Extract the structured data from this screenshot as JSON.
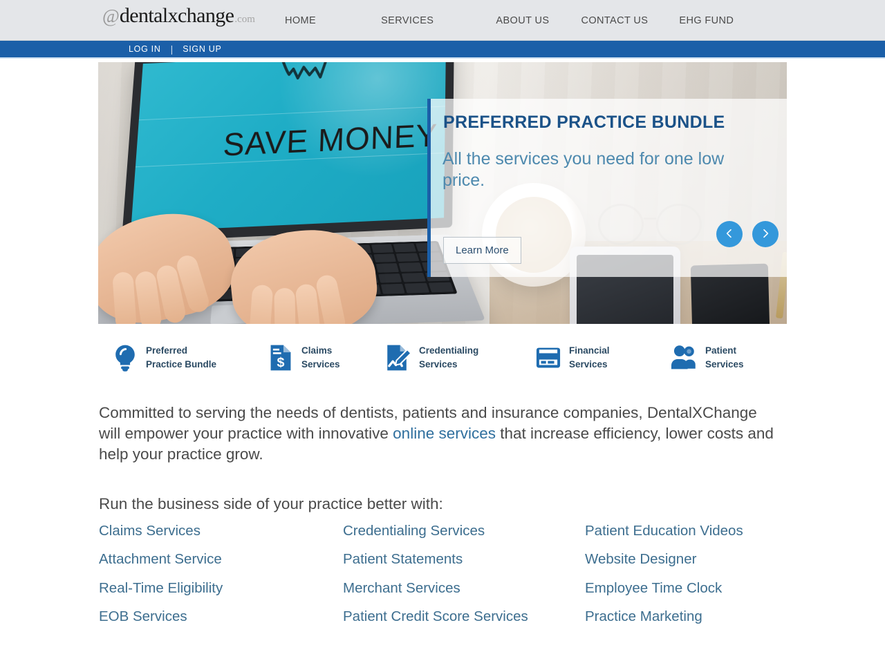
{
  "header": {
    "logo": {
      "at": "@",
      "word_before_x": "dental",
      "x": "x",
      "word_after_x": "change",
      "suffix": ".com"
    },
    "nav": [
      {
        "label": "HOME"
      },
      {
        "label": "SERVICES"
      },
      {
        "label": "ABOUT US"
      },
      {
        "label": "CONTACT US"
      },
      {
        "label": "EHG FUND"
      }
    ],
    "auth": {
      "login": "LOG IN",
      "separator": "|",
      "signup": "SIGN UP"
    },
    "colors": {
      "header_bg": "#e4e6e9",
      "auth_bar": "#1b5fa8",
      "logo_x": "#b02a2a"
    }
  },
  "hero": {
    "screen_text": "SAVE MONEY",
    "title": "PREFERRED PRACTICE BUNDLE",
    "subtitle": "All the services you need for one low price.",
    "cta_label": "Learn More",
    "prev_label": "Previous slide",
    "next_label": "Next slide",
    "colors": {
      "title": "#1b5288",
      "subtitle": "#4d89ae",
      "accent_bar": "#1b5fa8",
      "arrow_bg": "#3498db",
      "screen": "#1fadc6"
    }
  },
  "services": [
    {
      "label": "Preferred\nPractice Bundle",
      "icon": "lightbulb-icon"
    },
    {
      "label": "Claims\nServices",
      "icon": "document-dollar-icon"
    },
    {
      "label": "Credentialing\nServices",
      "icon": "document-pencil-icon"
    },
    {
      "label": "Financial\nServices",
      "icon": "credit-card-icon"
    },
    {
      "label": "Patient\nServices",
      "icon": "people-icon"
    }
  ],
  "intro": {
    "part1": "Committed to serving the needs of dentists, patients and insurance companies, DentalXChange will empower your practice with innovative ",
    "link": "online services",
    "part2": " that increase efficiency, lower costs and help your practice grow."
  },
  "run_section": {
    "title": "Run the business side of your practice better with:",
    "columns": [
      [
        "Claims Services",
        "Attachment Service",
        "Real-Time Eligibility",
        "EOB Services"
      ],
      [
        "Credentialing Services",
        "Patient Statements",
        "Merchant Services",
        "Patient Credit Score Services"
      ],
      [
        "Patient Education Videos",
        "Website Designer",
        "Employee Time Clock",
        "Practice Marketing"
      ]
    ]
  },
  "colors": {
    "link": "#3d6e8f",
    "body_text": "#4a4a4a",
    "icon_blue": "#1f6cb0"
  }
}
